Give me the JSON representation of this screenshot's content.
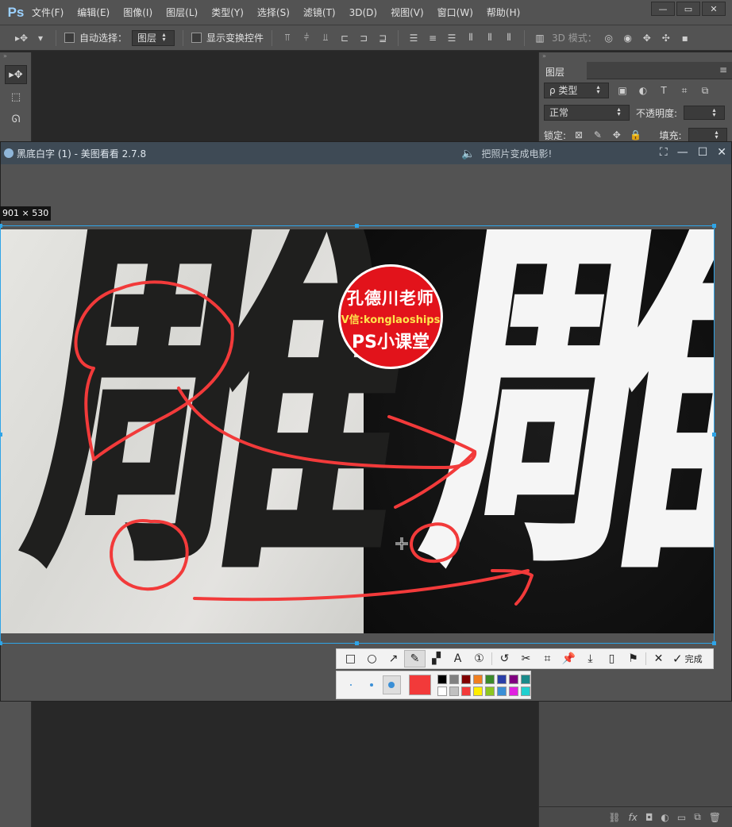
{
  "photoshop": {
    "logo": "Ps",
    "menu": [
      "文件(F)",
      "编辑(E)",
      "图像(I)",
      "图层(L)",
      "类型(Y)",
      "选择(S)",
      "滤镜(T)",
      "3D(D)",
      "视图(V)",
      "窗口(W)",
      "帮助(H)"
    ],
    "options": {
      "auto_select_label": "自动选择：",
      "auto_select_value": "图层",
      "show_transform_label": "显示变换控件",
      "mode_3d_label": "3D 模式："
    },
    "layers_panel": {
      "tab": "图层",
      "filter_label": "ρ 类型",
      "blend_mode": "正常",
      "opacity_label": "不透明度:",
      "lock_label": "锁定:",
      "fill_label": "填充:"
    }
  },
  "viewer": {
    "title": "黑底白字 (1) - 美图看看 2.7.8",
    "promo": "把照片变成电影!",
    "size_label": "901 × 530"
  },
  "image": {
    "character": "雕",
    "badge": {
      "line1": "孔德川老师",
      "line2": "V信:konglaoships",
      "line3": "PS小课堂"
    }
  },
  "screenshot_toolbar": {
    "tools": [
      "rectangle-icon",
      "ellipse-icon",
      "arrow-icon",
      "pencil-icon",
      "mosaic-icon",
      "text-icon",
      "number-icon",
      "undo-icon",
      "cut-icon",
      "crop-icon",
      "pin-icon",
      "download-icon",
      "save-icon",
      "bookmark-icon",
      "close-icon"
    ],
    "active_tool": "pencil-icon",
    "done_label": "完成",
    "current_color": "#f23a3a",
    "palette": [
      "#000000",
      "#808080",
      "#800000",
      "#f07f20",
      "#3a8a2a",
      "#2a3fa8",
      "#800080",
      "#1a8a8a",
      "#ffffff",
      "#c0c0c0",
      "#f23a3a",
      "#ffee00",
      "#8cc620",
      "#3a8fd6",
      "#e020e0",
      "#20d0d0"
    ]
  }
}
